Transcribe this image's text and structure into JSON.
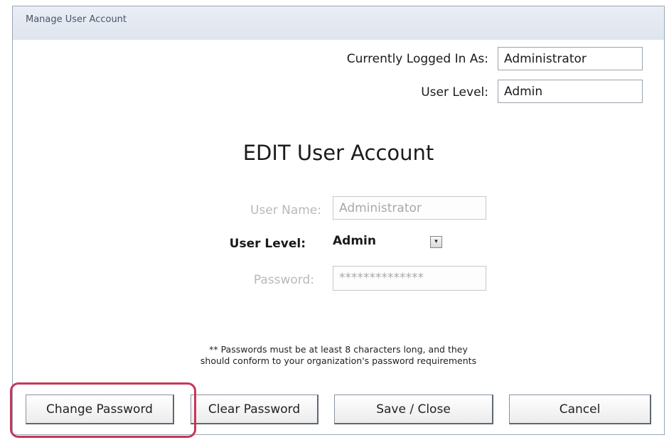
{
  "window": {
    "title": "Manage User Account"
  },
  "header": {
    "logged_in_label": "Currently Logged In As:",
    "logged_in_value": "Administrator",
    "user_level_label": "User Level:",
    "user_level_value": "Admin"
  },
  "form": {
    "heading": "EDIT User Account",
    "user_name_label": "User Name:",
    "user_name_value": "Administrator",
    "user_level_label": "User Level:",
    "user_level_selected": "Admin",
    "password_label": "Password:",
    "password_value": "**************",
    "note_line1": "** Passwords must be at least 8 characters long, and they",
    "note_line2": "should conform to your organization's password requirements"
  },
  "buttons": {
    "change_password": "Change Password",
    "clear_password": "Clear Password",
    "save_close": "Save / Close",
    "cancel": "Cancel"
  },
  "icons": {
    "dropdown_arrow": "▾"
  },
  "colors": {
    "highlight": "#c8365a"
  }
}
